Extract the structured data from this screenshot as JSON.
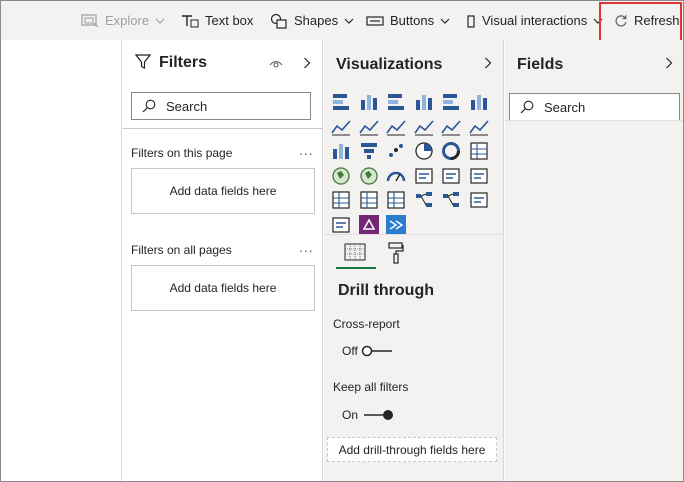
{
  "toolbar": {
    "explore_label": "Explore",
    "textbox_label": "Text box",
    "shapes_label": "Shapes",
    "buttons_label": "Buttons",
    "visual_interactions_label": "Visual interactions",
    "refresh_label": "Refresh",
    "highlight_color": "#d9372f"
  },
  "filters": {
    "title": "Filters",
    "search_placeholder": "Search",
    "this_page_label": "Filters on this page",
    "this_page_drop": "Add data fields here",
    "all_pages_label": "Filters on all pages",
    "all_pages_drop": "Add data fields here",
    "more": "..."
  },
  "visualizations": {
    "title": "Visualizations",
    "icons": [
      "stacked-bar-chart-icon",
      "stacked-column-chart-icon",
      "clustered-bar-chart-icon",
      "clustered-column-chart-icon",
      "100-stacked-bar-chart-icon",
      "100-stacked-column-chart-icon",
      "line-chart-icon",
      "area-chart-icon",
      "stacked-area-chart-icon",
      "line-and-column-chart-icon",
      "line-and-clustered-column-chart-icon",
      "ribbon-chart-icon",
      "waterfall-chart-icon",
      "funnel-chart-icon",
      "scatter-chart-icon",
      "pie-chart-icon",
      "donut-chart-icon",
      "treemap-icon",
      "map-icon",
      "filled-map-icon",
      "gauge-icon",
      "card-icon",
      "multi-row-card-icon",
      "kpi-icon",
      "slicer-icon",
      "table-icon",
      "matrix-icon",
      "key-influencers-icon",
      "decomposition-tree-icon",
      "qa-icon",
      "paginated-report-icon",
      "power-apps-icon",
      "power-automate-icon"
    ],
    "build_tab": "build-visual-tab-icon",
    "format_tab": "format-paint-roller-icon",
    "drill_title": "Drill through",
    "cross_report_label": "Cross-report",
    "cross_report_state": "Off",
    "keep_filters_label": "Keep all filters",
    "keep_filters_state": "On",
    "drill_drop": "Add drill-through fields here",
    "accent": "#107c41"
  },
  "fields": {
    "title": "Fields",
    "search_placeholder": "Search"
  }
}
